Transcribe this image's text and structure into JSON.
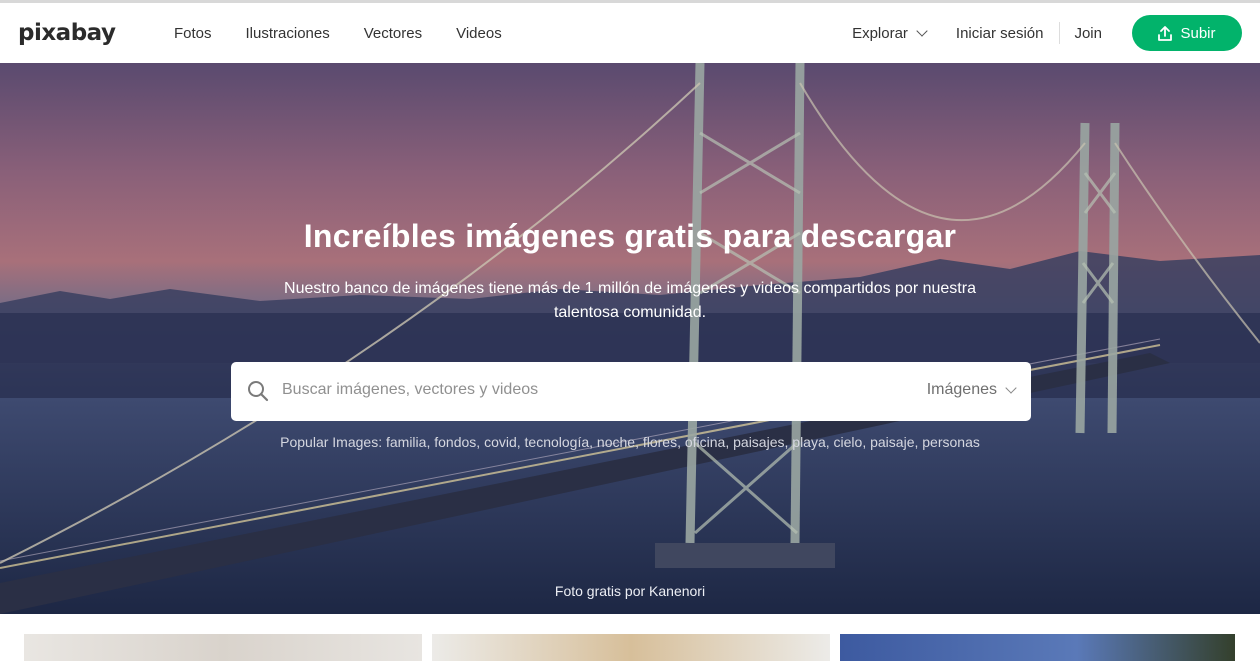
{
  "brand": {
    "logo": "pixabay"
  },
  "nav": {
    "left": [
      "Fotos",
      "Ilustraciones",
      "Vectores",
      "Videos"
    ],
    "explore": "Explorar",
    "login": "Iniciar sesión",
    "join": "Join",
    "upload": "Subir"
  },
  "hero": {
    "title": "Increíbles imágenes gratis para descargar",
    "subtitle": "Nuestro banco de imágenes tiene más de 1 millón de imágenes y videos compartidos por nuestra talentosa comunidad.",
    "credit": "Foto gratis por Kanenori"
  },
  "search": {
    "placeholder": "Buscar imágenes, vectores y videos",
    "type": "Imágenes"
  },
  "popular": {
    "label": "Popular Images:",
    "tags": [
      "familia",
      "fondos",
      "covid",
      "tecnología",
      "noche",
      "flores",
      "oficina",
      "paisajes",
      "playa",
      "cielo",
      "paisaje",
      "personas"
    ]
  },
  "colors": {
    "accent": "#02b36b"
  }
}
